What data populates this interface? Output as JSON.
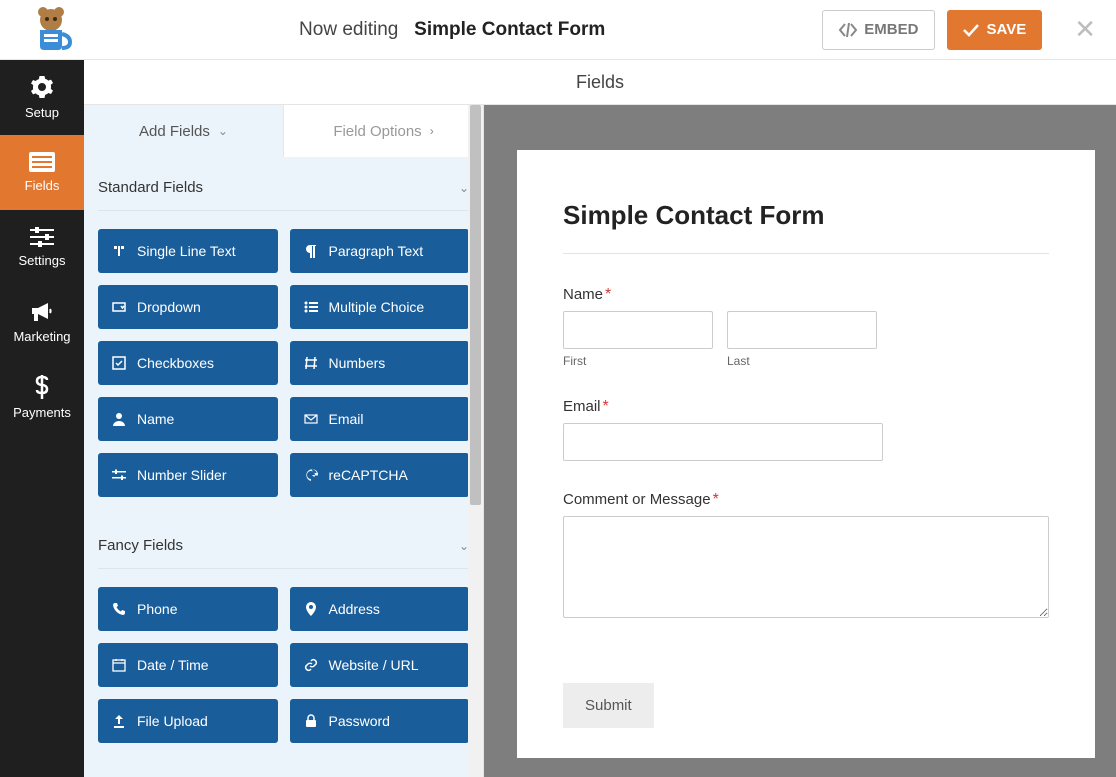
{
  "top": {
    "editing_prefix": "Now editing",
    "form_name": "Simple Contact Form",
    "embed": "EMBED",
    "save": "SAVE"
  },
  "side": {
    "setup": "Setup",
    "fields": "Fields",
    "settings": "Settings",
    "marketing": "Marketing",
    "payments": "Payments"
  },
  "crumb": "Fields",
  "tabs": {
    "add": "Add Fields",
    "options": "Field Options"
  },
  "sections": {
    "standard": "Standard Fields",
    "fancy": "Fancy Fields"
  },
  "fields": {
    "single_line": "Single Line Text",
    "paragraph": "Paragraph Text",
    "dropdown": "Dropdown",
    "multiple": "Multiple Choice",
    "checkboxes": "Checkboxes",
    "numbers": "Numbers",
    "name": "Name",
    "email": "Email",
    "slider": "Number Slider",
    "recaptcha": "reCAPTCHA",
    "phone": "Phone",
    "address": "Address",
    "datetime": "Date / Time",
    "website": "Website / URL",
    "upload": "File Upload",
    "password": "Password"
  },
  "form": {
    "title": "Simple Contact Form",
    "name": "Name",
    "first": "First",
    "last": "Last",
    "email": "Email",
    "comment": "Comment or Message",
    "submit": "Submit"
  }
}
